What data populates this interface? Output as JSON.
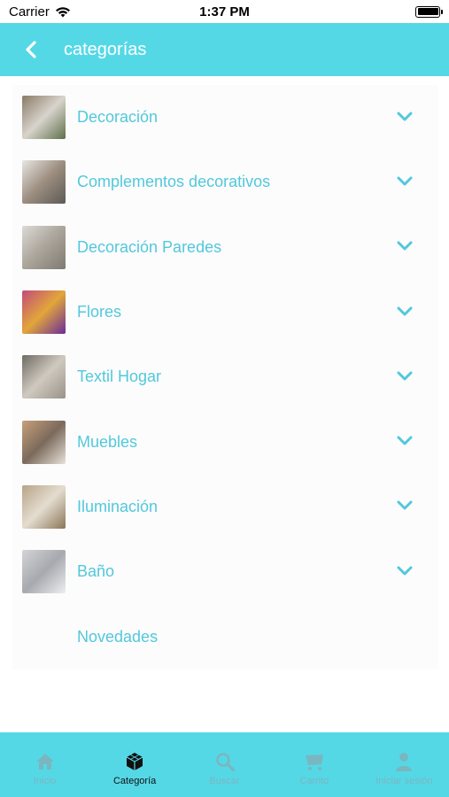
{
  "status_bar": {
    "carrier": "Carrier",
    "time": "1:37 PM"
  },
  "nav": {
    "title": "categorías"
  },
  "categories": [
    {
      "label": "Decoración",
      "thumb_colors": [
        "#8a7a66",
        "#d8d4cc",
        "#5f6f4a"
      ]
    },
    {
      "label": "Complementos decorativos",
      "thumb_colors": [
        "#e8e6e2",
        "#9c8e80",
        "#5d5a55"
      ]
    },
    {
      "label": "Decoración Paredes",
      "thumb_colors": [
        "#dcdad6",
        "#aaa49a",
        "#7f7a72"
      ]
    },
    {
      "label": "Flores",
      "thumb_colors": [
        "#c24b7b",
        "#e2a63a",
        "#6a2a9c"
      ]
    },
    {
      "label": "Textil Hogar",
      "thumb_colors": [
        "#6f6a62",
        "#cfc9c0",
        "#9a9288"
      ]
    },
    {
      "label": "Muebles",
      "thumb_colors": [
        "#c7a07a",
        "#7b6a5c",
        "#e8e2d8"
      ]
    },
    {
      "label": "Iluminación",
      "thumb_colors": [
        "#b7a488",
        "#e4ddd0",
        "#8a7658"
      ]
    },
    {
      "label": "Baño",
      "thumb_colors": [
        "#d4d4d6",
        "#a7a9ae",
        "#eceef0"
      ]
    }
  ],
  "extra_item": {
    "label": "Novedades"
  },
  "tabs": [
    {
      "label": "Inicio",
      "icon": "home-icon",
      "active": false
    },
    {
      "label": "Categoría",
      "icon": "cube-icon",
      "active": true
    },
    {
      "label": "Buscar",
      "icon": "search-icon",
      "active": false
    },
    {
      "label": "Carrito",
      "icon": "cart-icon",
      "active": false
    },
    {
      "label": "Iniciar sesión",
      "icon": "user-icon",
      "active": false
    }
  ],
  "colors": {
    "accent": "#55d8e6",
    "label_text": "#52c8dc",
    "tab_inactive": "#7ab6c0"
  }
}
